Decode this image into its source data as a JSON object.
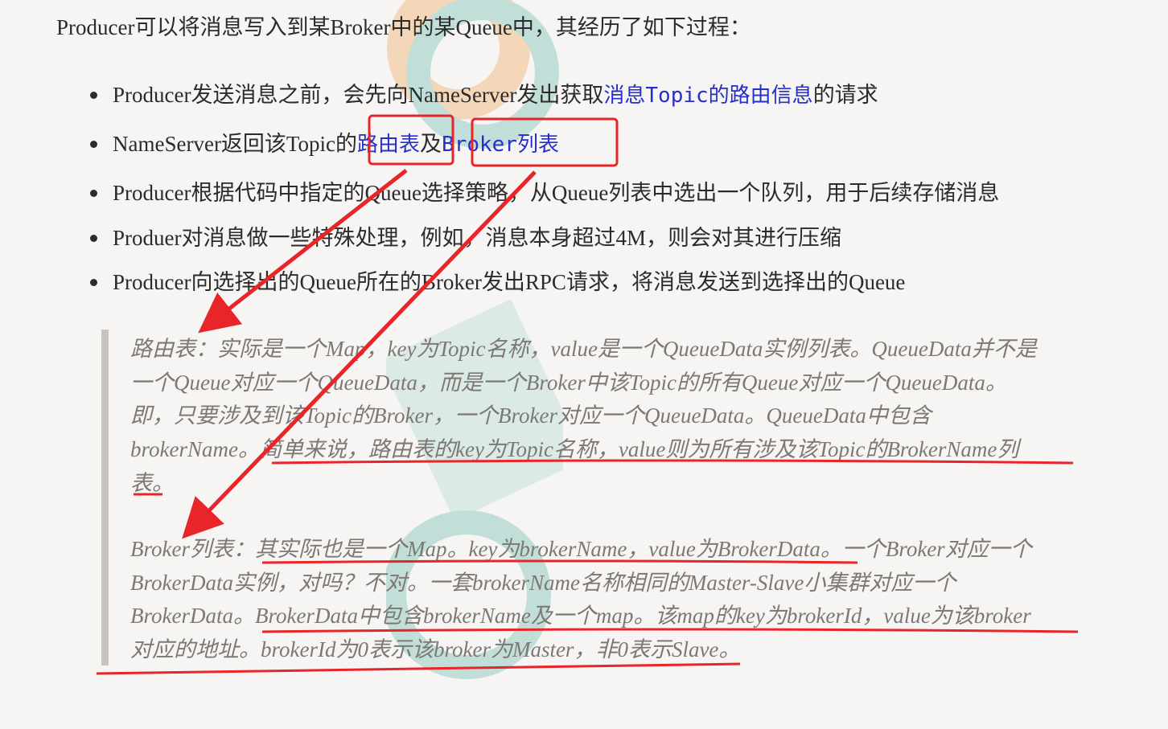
{
  "intro": "Producer可以将消息写入到某Broker中的某Queue中，其经历了如下过程：",
  "steps": [
    {
      "pre": "Producer发送消息之前，会先向NameServer发出获取",
      "code": "消息Topic的路由信息",
      "post": "的请求"
    },
    {
      "pre": "NameServer返回该Topic的",
      "code": "路由表",
      "mid": "及",
      "code2": "Broker列表"
    },
    {
      "pre": "Producer根据代码中指定的Queue选择策略，从Queue列表中选出一个队列，用于后续存储消息"
    },
    {
      "pre": "Produer对消息做一些特殊处理，例如，消息本身超过4M，则会对其进行压缩"
    },
    {
      "pre": "Producer向选择出的Queue所在的Broker发出RPC请求，将消息发送到选择出的Queue"
    }
  ],
  "quote": {
    "route_lines": [
      "路由表：实际是一个Map，key为Topic名称，value是一个QueueData实例列表。QueueData并不是",
      "一个Queue对应一个QueueData，而是一个Broker中该Topic的所有Queue对应一个QueueData。",
      "即，只要涉及到该Topic的Broker，一个Broker对应一个QueueData。QueueData中包含",
      "brokerName。简单来说，路由表的key为Topic名称，value则为所有涉及该Topic的BrokerName列",
      "表。"
    ],
    "broker_lines": [
      "Broker列表：其实际也是一个Map。key为brokerName，value为BrokerData。一个Broker对应一个",
      "BrokerData实例，对吗？不对。一套brokerName名称相同的Master-Slave小集群对应一个",
      "BrokerData。BrokerData中包含brokerName及一个map。该map的key为brokerId，value为该broker",
      "对应的地址。brokerId为0表示该broker为Master，非0表示Slave。"
    ]
  },
  "colors": {
    "annotation": "#e8262a",
    "code": "#2530c8",
    "quote_text": "#7c7874",
    "quote_bar": "#c8c4c0"
  }
}
